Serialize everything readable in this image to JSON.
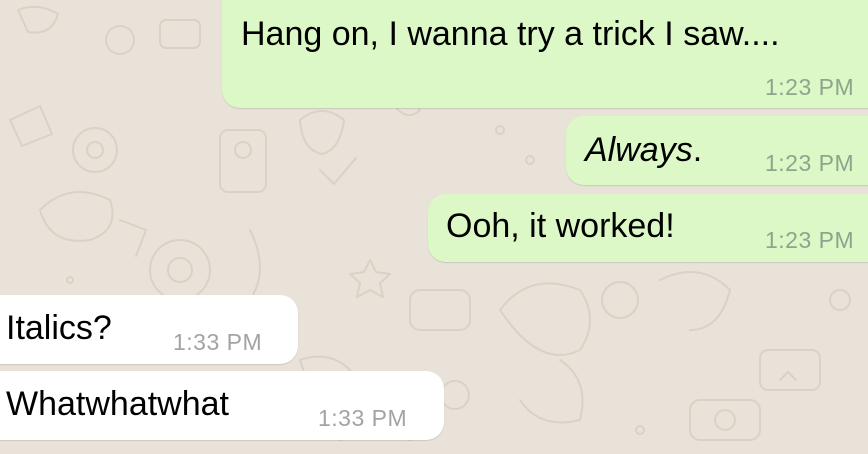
{
  "colors": {
    "chat_background": "#e8e2d8",
    "outgoing_bubble": "#dcf8c6",
    "incoming_bubble": "#ffffff",
    "outgoing_time": "#8fa48c",
    "incoming_time": "#a3a3a3"
  },
  "messages": [
    {
      "direction": "outgoing",
      "text": "Hang on, I wanna try a trick I saw....",
      "time": "1:23 PM",
      "italic": false
    },
    {
      "direction": "outgoing",
      "text": "Always",
      "suffix": ".",
      "time": "1:23 PM",
      "italic": true
    },
    {
      "direction": "outgoing",
      "text": "Ooh, it worked!",
      "time": "1:23 PM",
      "italic": false
    },
    {
      "direction": "incoming",
      "text": "Italics?",
      "time": "1:33 PM",
      "italic": false
    },
    {
      "direction": "incoming",
      "text": "Whatwhatwhat",
      "time": "1:33 PM",
      "italic": false
    }
  ]
}
